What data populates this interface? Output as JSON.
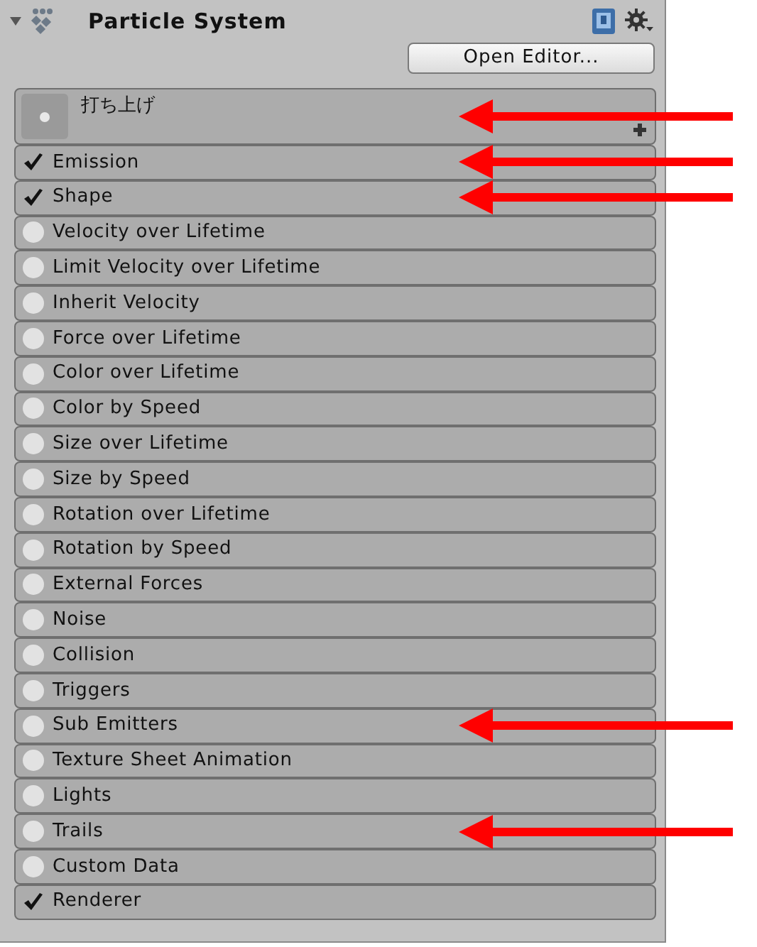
{
  "component": {
    "title": "Particle System",
    "expanded": true
  },
  "open_editor_button": "Open Editor...",
  "main_module": {
    "name": "打ち上げ",
    "annotated": true
  },
  "modules": [
    {
      "name": "Emission",
      "enabled": true,
      "annotated": true
    },
    {
      "name": "Shape",
      "enabled": true,
      "annotated": true
    },
    {
      "name": "Velocity over Lifetime",
      "enabled": false,
      "annotated": false
    },
    {
      "name": "Limit Velocity over Lifetime",
      "enabled": false,
      "annotated": false
    },
    {
      "name": "Inherit Velocity",
      "enabled": false,
      "annotated": false
    },
    {
      "name": "Force over Lifetime",
      "enabled": false,
      "annotated": false
    },
    {
      "name": "Color over Lifetime",
      "enabled": false,
      "annotated": false
    },
    {
      "name": "Color by Speed",
      "enabled": false,
      "annotated": false
    },
    {
      "name": "Size over Lifetime",
      "enabled": false,
      "annotated": false
    },
    {
      "name": "Size by Speed",
      "enabled": false,
      "annotated": false
    },
    {
      "name": "Rotation over Lifetime",
      "enabled": false,
      "annotated": false
    },
    {
      "name": "Rotation by Speed",
      "enabled": false,
      "annotated": false
    },
    {
      "name": "External Forces",
      "enabled": false,
      "annotated": false
    },
    {
      "name": "Noise",
      "enabled": false,
      "annotated": false
    },
    {
      "name": "Collision",
      "enabled": false,
      "annotated": false
    },
    {
      "name": "Triggers",
      "enabled": false,
      "annotated": false
    },
    {
      "name": "Sub Emitters",
      "enabled": false,
      "annotated": true
    },
    {
      "name": "Texture Sheet Animation",
      "enabled": false,
      "annotated": false
    },
    {
      "name": "Lights",
      "enabled": false,
      "annotated": false
    },
    {
      "name": "Trails",
      "enabled": false,
      "annotated": true
    },
    {
      "name": "Custom Data",
      "enabled": false,
      "annotated": false
    },
    {
      "name": "Renderer",
      "enabled": true,
      "annotated": false
    }
  ]
}
